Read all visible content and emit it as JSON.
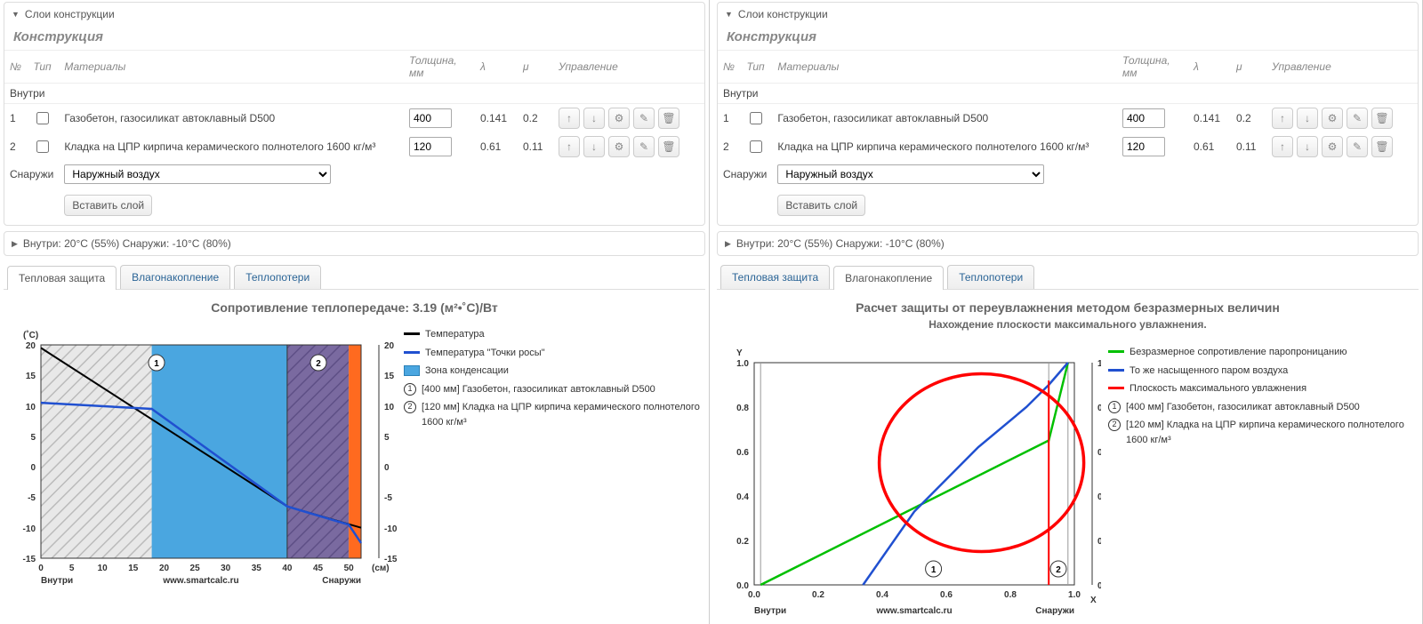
{
  "left": {
    "panel_title": "Слои конструкции",
    "section_title": "Конструкция",
    "headers": {
      "no": "№",
      "type": "Тип",
      "materials": "Материалы",
      "thickness": "Толщина, мм",
      "lambda": "λ",
      "mu": "μ",
      "manage": "Управление"
    },
    "inside_label": "Внутри",
    "outside_label": "Снаружи",
    "outside_value": "Наружный воздух",
    "insert_button": "Вставить слой",
    "rows": [
      {
        "no": "1",
        "material": "Газобетон, газосиликат автоклавный D500",
        "thickness": "400",
        "lambda": "0.141",
        "mu": "0.2"
      },
      {
        "no": "2",
        "material": "Кладка на ЦПР кирпича керамического полнотелого 1600 кг/м³",
        "thickness": "120",
        "lambda": "0.61",
        "mu": "0.11"
      }
    ],
    "env_panel": "Внутри: 20°C (55%) Снаружи: -10°C (80%)",
    "tabs": [
      "Тепловая защита",
      "Влагонакопление",
      "Теплопотери"
    ],
    "active_tab": 0,
    "chart_title": "Сопротивление теплопередаче: 3.19 (м²•˚С)/Вт",
    "legend": {
      "s1": "Температура",
      "s2": "Температура \"Точки росы\"",
      "s3": "Зона конденсации",
      "l1": "[400 мм] Газобетон, газосиликат автоклавный D500",
      "l2": "[120 мм] Кладка на ЦПР кирпича керамического полнотелого 1600 кг/м³"
    },
    "axes": {
      "y_unit": "(˚С)",
      "x_unit": "(см)",
      "x_in": "Внутри",
      "x_out": "Снаружи",
      "site": "www.smartcalc.ru"
    }
  },
  "right": {
    "panel_title": "Слои конструкции",
    "section_title": "Конструкция",
    "headers": {
      "no": "№",
      "type": "Тип",
      "materials": "Материалы",
      "thickness": "Толщина, мм",
      "lambda": "λ",
      "mu": "μ",
      "manage": "Управление"
    },
    "inside_label": "Внутри",
    "outside_label": "Снаружи",
    "outside_value": "Наружный воздух",
    "insert_button": "Вставить слой",
    "rows": [
      {
        "no": "1",
        "material": "Газобетон, газосиликат автоклавный D500",
        "thickness": "400",
        "lambda": "0.141",
        "mu": "0.2"
      },
      {
        "no": "2",
        "material": "Кладка на ЦПР кирпича керамического полнотелого 1600 кг/м³",
        "thickness": "120",
        "lambda": "0.61",
        "mu": "0.11"
      }
    ],
    "env_panel": "Внутри: 20°C (55%) Снаружи: -10°C (80%)",
    "tabs": [
      "Тепловая защита",
      "Влагонакопление",
      "Теплопотери"
    ],
    "active_tab": 1,
    "chart_title": "Расчет защиты от переувлажнения методом безразмерных величин",
    "chart_sub": "Нахождение плоскости максимального увлажнения.",
    "legend": {
      "s1": "Безразмерное сопротивление паропроницанию",
      "s2": "То же насыщенного паром воздуха",
      "s3": "Плоскость максимального увлажнения",
      "l1": "[400 мм] Газобетон, газосиликат автоклавный D500",
      "l2": "[120 мм] Кладка на ЦПР кирпича керамического полнотелого 1600 кг/м³"
    },
    "axes": {
      "y_unit": "Y",
      "x_unit": "X",
      "x_in": "Внутри",
      "x_out": "Снаружи",
      "site": "www.smartcalc.ru"
    }
  },
  "chart_data": [
    {
      "panel": "left",
      "type": "line",
      "title": "Сопротивление теплопередаче: 3.19 (м²•˚С)/Вт",
      "xlabel": "см",
      "ylabel": "˚С",
      "x_ticks": [
        0,
        5,
        10,
        15,
        20,
        25,
        30,
        35,
        40,
        45,
        50
      ],
      "y_ticks": [
        -15,
        -10,
        -5,
        0,
        5,
        10,
        15,
        20
      ],
      "xlim": [
        0,
        52
      ],
      "ylim": [
        -15,
        20
      ],
      "layer_boundaries_cm": [
        0,
        40,
        52
      ],
      "series": [
        {
          "name": "Температура",
          "color": "#000",
          "x": [
            0,
            40,
            52
          ],
          "y": [
            19.5,
            -6.5,
            -10
          ]
        },
        {
          "name": "Температура \"Точки росы\"",
          "color": "#2050d0",
          "x": [
            0,
            18,
            40,
            50,
            52
          ],
          "y": [
            10.5,
            9.5,
            -6,
            -9,
            -12
          ]
        }
      ],
      "condensation_zone_cm": [
        18,
        50
      ],
      "zone_color": "#4aa6e0",
      "annotations": [
        {
          "label": "1",
          "x_cm": 18
        },
        {
          "label": "2",
          "x_cm": 45
        }
      ],
      "right_strip_color": "#ff6a1f"
    },
    {
      "panel": "right",
      "type": "line",
      "title": "Нахождение плоскости максимального увлажнения.",
      "xlabel": "",
      "ylabel": "",
      "x_ticks": [
        0.0,
        0.2,
        0.4,
        0.6,
        0.8,
        1.0
      ],
      "y_ticks": [
        0.0,
        0.2,
        0.4,
        0.6,
        0.8,
        1.0
      ],
      "xlim": [
        0,
        1
      ],
      "ylim": [
        0,
        1
      ],
      "layer_boundaries_x": [
        0.02,
        0.92,
        0.98
      ],
      "series": [
        {
          "name": "Безразмерное сопротивление паропроницанию",
          "color": "#00c000",
          "x": [
            0.02,
            0.92,
            0.98
          ],
          "y": [
            0.0,
            0.65,
            1.0
          ]
        },
        {
          "name": "То же насыщенного паром воздуха",
          "color": "#2050d0",
          "x": [
            0.34,
            0.5,
            0.7,
            0.85,
            0.92,
            0.98
          ],
          "y": [
            0.0,
            0.33,
            0.62,
            0.8,
            0.9,
            1.0
          ]
        },
        {
          "name": "Плоскость максимального увлажнения",
          "color": "#ff0000",
          "x": [
            0.92,
            0.92
          ],
          "y": [
            0.0,
            0.92
          ]
        }
      ],
      "annotations": [
        {
          "label": "1",
          "x": 0.56
        },
        {
          "label": "2",
          "x": 0.95
        }
      ],
      "highlight_ellipse": {
        "cx": 0.71,
        "cy": 0.55,
        "rx": 0.32,
        "ry": 0.4,
        "stroke": "#ff0000"
      }
    }
  ]
}
